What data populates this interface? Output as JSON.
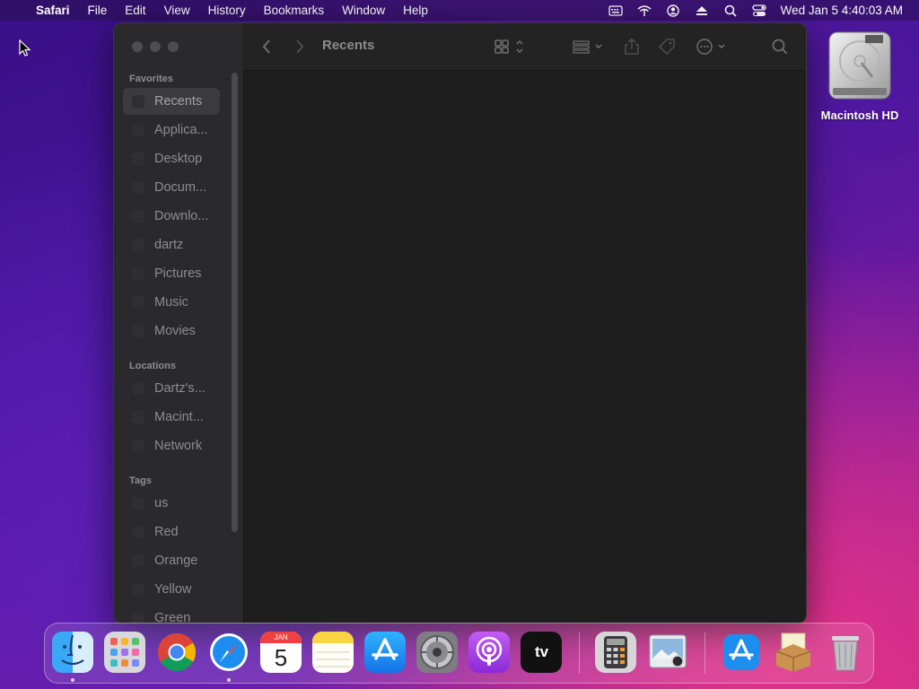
{
  "menubar": {
    "apple_symbol": "",
    "app_name": "Safari",
    "items": [
      "File",
      "Edit",
      "View",
      "History",
      "Bookmarks",
      "Window",
      "Help"
    ],
    "status_icons": [
      "keyboard-viewer-icon",
      "wifi-icon",
      "user-icon",
      "eject-icon",
      "spotlight-icon",
      "control-center-icon"
    ],
    "clock": "Wed Jan 5  4:40:03 AM"
  },
  "finder": {
    "title": "Recents",
    "sidebar": {
      "favorites_title": "Favorites",
      "favorites": [
        "Recents",
        "Applica...",
        "Desktop",
        "Docum...",
        "Downlo...",
        "dartz",
        "Pictures",
        "Music",
        "Movies"
      ],
      "locations_title": "Locations",
      "locations": [
        "Dartz's...",
        "Macint...",
        "Network"
      ],
      "tags_title": "Tags",
      "tags": [
        "us",
        "Red",
        "Orange",
        "Yellow",
        "Green"
      ]
    },
    "toolbar_icons": [
      "back-icon",
      "forward-icon",
      "icon-view-icon",
      "group-icon",
      "share-icon",
      "tag-icon",
      "more-icon",
      "search-icon"
    ]
  },
  "desktop": {
    "hd_label": "Macintosh HD"
  },
  "dock": {
    "apps": [
      "Finder",
      "Launchpad",
      "Chrome",
      "Safari",
      "Calendar",
      "Notes",
      "App Store",
      "System Preferences",
      "Podcasts",
      "Apple TV",
      "Calculator",
      "Preview",
      "App Store",
      "Archive Utility",
      "Trash"
    ],
    "calendar_month": "JAN",
    "calendar_day": "5",
    "tv_label": "tv"
  }
}
